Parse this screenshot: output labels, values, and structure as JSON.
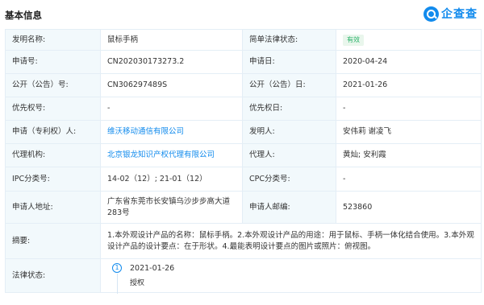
{
  "header": {
    "title": "基本信息",
    "brand": "企查查"
  },
  "rows": {
    "invention_name_label": "发明名称:",
    "invention_name": "鼠标手柄",
    "legal_status_label": "简单法律状态:",
    "legal_status": "有效",
    "app_no_label": "申请号:",
    "app_no": "CN202030173273.2",
    "app_date_label": "申请日:",
    "app_date": "2020-04-24",
    "pub_no_label": "公开（公告）号:",
    "pub_no": "CN306297489S",
    "pub_date_label": "公开（公告）日:",
    "pub_date": "2021-01-26",
    "priority_no_label": "优先权号:",
    "priority_no": "-",
    "priority_date_label": "优先权日:",
    "priority_date": "-",
    "applicant_label": "申请（专利权）人:",
    "applicant": "维沃移动通信有限公司",
    "inventor_label": "发明人:",
    "inventor": "安伟莉 谢凌飞",
    "agency_label": "代理机构:",
    "agency": "北京银龙知识产权代理有限公司",
    "agent_label": "代理人:",
    "agent": "黄灿; 安利霞",
    "ipc_label": "IPC分类号:",
    "ipc": "14-02（12）;   21-01（12）",
    "cpc_label": "CPC分类号:",
    "cpc": "-",
    "address_label": "申请人地址:",
    "address": "广东省东莞市长安镇乌沙步步高大道283号",
    "postcode_label": "申请人邮编:",
    "postcode": "523860",
    "abstract_label": "摘要:",
    "abstract": "1.本外观设计产品的名称：鼠标手柄。2.本外观设计产品的用途：用于鼠标、手柄一体化结合使用。3.本外观设计产品的设计要点：在于形状。4.最能表明设计要点的图片或照片：俯视图。",
    "legal_label": "法律状态:"
  },
  "legal_timeline": [
    {
      "index": "1",
      "date": "2021-01-26",
      "event": "授权"
    }
  ],
  "colors": {
    "accent": "#128bed",
    "label_bg": "#f2f9fc",
    "status_green": "#2bb36a",
    "border": "#e4eef6"
  }
}
